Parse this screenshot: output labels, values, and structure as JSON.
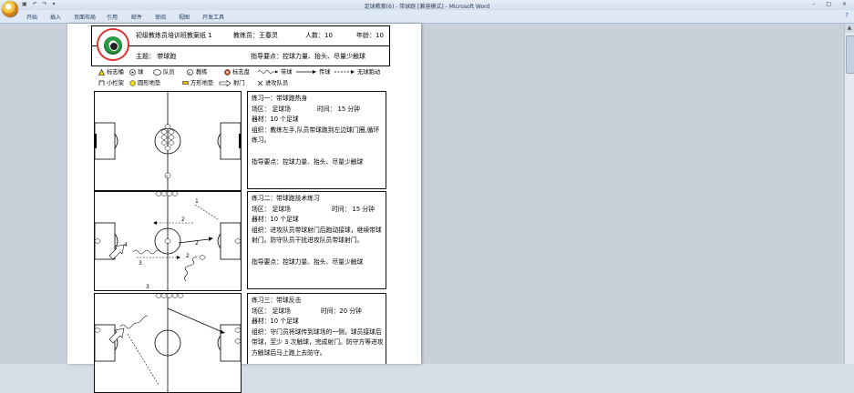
{
  "window": {
    "title": "足球教案(6) - 带球跑 [兼容模式] - Microsoft Word",
    "qat": "▣ ↶ ↷ ▾",
    "controls": "– □ ×"
  },
  "ribbon": {
    "tabs": [
      "开始",
      "插入",
      "页面布局",
      "引用",
      "邮件",
      "审阅",
      "视图",
      "开发工具"
    ],
    "help": "?"
  },
  "header": {
    "title": "初级教练员培训班教案纸 1",
    "coach_label": "教练员：王春灵",
    "count_label": "人数：10",
    "age_label": "年龄：10",
    "theme_label": "主题：  带球跑",
    "keypoints_label": "指导要点：控球力量、抬头、尽量少触球"
  },
  "legend": {
    "items": [
      {
        "icon": "triangle-marker-icon",
        "label": "标志桶"
      },
      {
        "icon": "ball-icon",
        "label": "球"
      },
      {
        "icon": "player-icon",
        "label": "队员"
      },
      {
        "icon": "coach-icon",
        "label": "教练"
      },
      {
        "icon": "disc-marker-icon",
        "label": "标志盘"
      },
      {
        "icon": "dribble-line-icon",
        "label": "带球"
      },
      {
        "icon": "pass-arrow-icon",
        "label": "传球"
      },
      {
        "icon": "run-dashed-icon",
        "label": "无球跑动"
      },
      {
        "icon": "small-goal-icon",
        "label": "小栏架"
      },
      {
        "icon": "round-mat-icon",
        "label": "圆形地垫"
      },
      {
        "icon": "square-mat-icon",
        "label": "方形地垫"
      },
      {
        "icon": "shot-arrow-icon",
        "label": "射门"
      },
      {
        "icon": "attack-cross-icon",
        "label": "进攻队员"
      }
    ]
  },
  "exercises": [
    {
      "name": "练习一：带球跑热身",
      "area_label": "场区：  足球场",
      "time_label": "时间：  15 分钟",
      "equipment": "器材：10 个足球",
      "org1": "组织：教练左手,队员带球跑到左边球门圈,循环",
      "org2": "练习。",
      "keypoints": "指导要点：控球力量、抬头、尽量少触球"
    },
    {
      "name": "练习二：带球跑技术练习",
      "area_label": "场区：  足球场",
      "time_label": "时间：  15 分钟",
      "equipment": "器材：10 个足球",
      "org1": "组织：进攻队员带球射门后跑动接球，继续带球",
      "org2": "射门。防守队员干扰进攻队员带球射门。",
      "keypoints": "指导要点：控球力量、抬头、尽量少触球"
    },
    {
      "name": "练习三：带球反击",
      "area_label": "场区：  足球场",
      "time_label": "时间：20 分钟",
      "equipment": "器材：10 个足球",
      "org1": "组织：守门员将球传到球场的一侧，球员接球后",
      "org2": "带球，至少 3 次触球，完成射门。防守方等进攻",
      "org3": "方触球后马上跑上去防守。"
    }
  ],
  "diagram2": {
    "numbers": [
      "1",
      "2",
      "3",
      "4",
      "2",
      "2",
      "3"
    ]
  }
}
